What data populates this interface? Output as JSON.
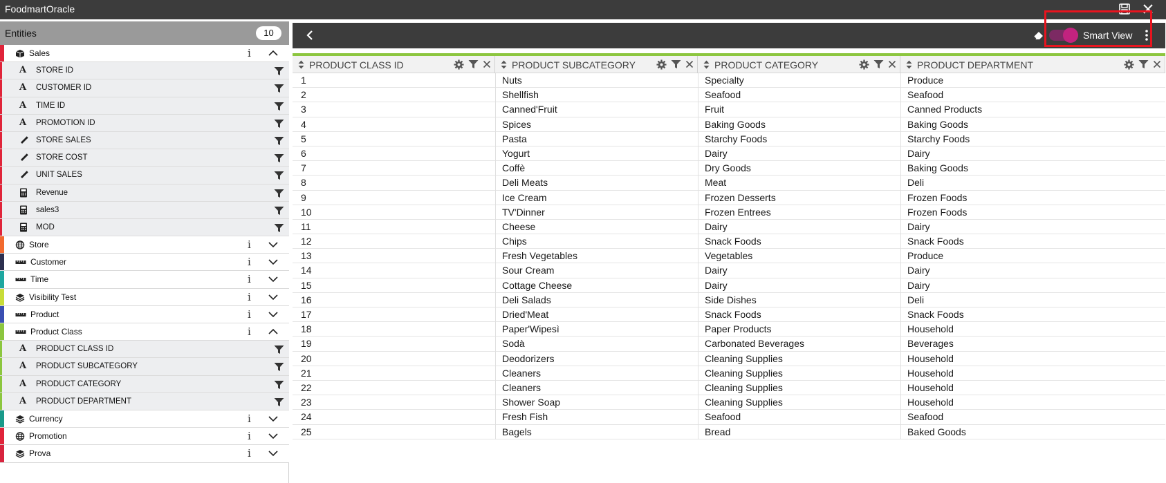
{
  "window": {
    "title": "FoodmartOracle",
    "save_icon": "save-icon",
    "close_icon": "close-icon"
  },
  "sidebar": {
    "header_label": "Entities",
    "count": "10",
    "entities": [
      {
        "label": "Sales",
        "icon": "cube-icon",
        "color": "#e0243a",
        "expanded": true,
        "fields": [
          {
            "label": "STORE ID",
            "icon": "attribute-icon"
          },
          {
            "label": "CUSTOMER ID",
            "icon": "attribute-icon"
          },
          {
            "label": "TIME ID",
            "icon": "attribute-icon"
          },
          {
            "label": "PROMOTION ID",
            "icon": "attribute-icon"
          },
          {
            "label": "STORE SALES",
            "icon": "ruler-icon"
          },
          {
            "label": "STORE COST",
            "icon": "ruler-icon"
          },
          {
            "label": "UNIT SALES",
            "icon": "ruler-icon"
          },
          {
            "label": "Revenue",
            "icon": "calculator-icon"
          },
          {
            "label": "sales3",
            "icon": "calculator-icon"
          },
          {
            "label": "MOD",
            "icon": "calculator-icon"
          }
        ]
      },
      {
        "label": "Store",
        "icon": "globe-icon",
        "color": "#f26a2e",
        "expanded": false,
        "fields": []
      },
      {
        "label": "Customer",
        "icon": "ruler-icon",
        "color": "#2c2f4f",
        "expanded": false,
        "fields": []
      },
      {
        "label": "Time",
        "icon": "ruler-icon",
        "color": "#1ea7a0",
        "expanded": false,
        "fields": []
      },
      {
        "label": "Visibility Test",
        "icon": "layers-icon",
        "color": "#c8dc38",
        "expanded": false,
        "fields": []
      },
      {
        "label": "Product",
        "icon": "ruler-icon",
        "color": "#3a4fb2",
        "expanded": false,
        "fields": []
      },
      {
        "label": "Product Class",
        "icon": "ruler-icon",
        "color": "#8cc63f",
        "expanded": true,
        "fields": [
          {
            "label": "PRODUCT CLASS ID",
            "icon": "attribute-icon"
          },
          {
            "label": "PRODUCT SUBCATEGORY",
            "icon": "attribute-icon"
          },
          {
            "label": "PRODUCT CATEGORY",
            "icon": "attribute-icon"
          },
          {
            "label": "PRODUCT DEPARTMENT",
            "icon": "attribute-icon"
          }
        ]
      },
      {
        "label": "Currency",
        "icon": "layers-icon",
        "color": "#1a9a8a",
        "expanded": false,
        "fields": []
      },
      {
        "label": "Promotion",
        "icon": "globe-icon",
        "color": "#e0243a",
        "expanded": false,
        "fields": []
      },
      {
        "label": "Prova",
        "icon": "layers-icon",
        "color": "#d8243e",
        "expanded": false,
        "fields": []
      }
    ]
  },
  "toolbar": {
    "back_icon": "back-chevron-icon",
    "eraser_icon": "eraser-icon",
    "smart_view_label": "Smart View",
    "smart_view_enabled": true,
    "menu_icon": "kebab-menu-icon",
    "accent_color": "#c2237f"
  },
  "table": {
    "columns": [
      "PRODUCT CLASS ID",
      "PRODUCT SUBCATEGORY",
      "PRODUCT CATEGORY",
      "PRODUCT DEPARTMENT"
    ],
    "rows": [
      [
        "1",
        "Nuts",
        "Specialty",
        "Produce"
      ],
      [
        "2",
        "Shellfish",
        "Seafood",
        "Seafood"
      ],
      [
        "3",
        "Canned'Fruit",
        "Fruit",
        "Canned Products"
      ],
      [
        "4",
        "Spices",
        "Baking Goods",
        "Baking Goods"
      ],
      [
        "5",
        "Pasta",
        "Starchy Foods",
        "Starchy Foods"
      ],
      [
        "6",
        "Yogurt",
        "Dairy",
        "Dairy"
      ],
      [
        "7",
        "Coffè",
        "Dry Goods",
        "Baking Goods"
      ],
      [
        "8",
        "Deli Meats",
        "Meat",
        "Deli"
      ],
      [
        "9",
        "Ice Cream",
        "Frozen Desserts",
        "Frozen Foods"
      ],
      [
        "10",
        "TV'Dinner",
        "Frozen Entrees",
        "Frozen Foods"
      ],
      [
        "11",
        "Cheese",
        "Dairy",
        "Dairy"
      ],
      [
        "12",
        "Chips",
        "Snack Foods",
        "Snack Foods"
      ],
      [
        "13",
        "Fresh Vegetables",
        "Vegetables",
        "Produce"
      ],
      [
        "14",
        "Sour Cream",
        "Dairy",
        "Dairy"
      ],
      [
        "15",
        "Cottage Cheese",
        "Dairy",
        "Dairy"
      ],
      [
        "16",
        "Deli Salads",
        "Side Dishes",
        "Deli"
      ],
      [
        "17",
        "Dried'Meat",
        "Snack Foods",
        "Snack Foods"
      ],
      [
        "18",
        "Paper'Wipesì",
        "Paper Products",
        "Household"
      ],
      [
        "19",
        "Sodà",
        "Carbonated Beverages",
        "Beverages"
      ],
      [
        "20",
        "Deodorizers",
        "Cleaning Supplies",
        "Household"
      ],
      [
        "21",
        "Cleaners",
        "Cleaning Supplies",
        "Household"
      ],
      [
        "22",
        "Cleaners",
        "Cleaning Supplies",
        "Household"
      ],
      [
        "23",
        "Shower Soap",
        "Cleaning Supplies",
        "Household"
      ],
      [
        "24",
        "Fresh Fish",
        "Seafood",
        "Seafood"
      ],
      [
        "25",
        "Bagels",
        "Bread",
        "Baked Goods"
      ]
    ]
  }
}
